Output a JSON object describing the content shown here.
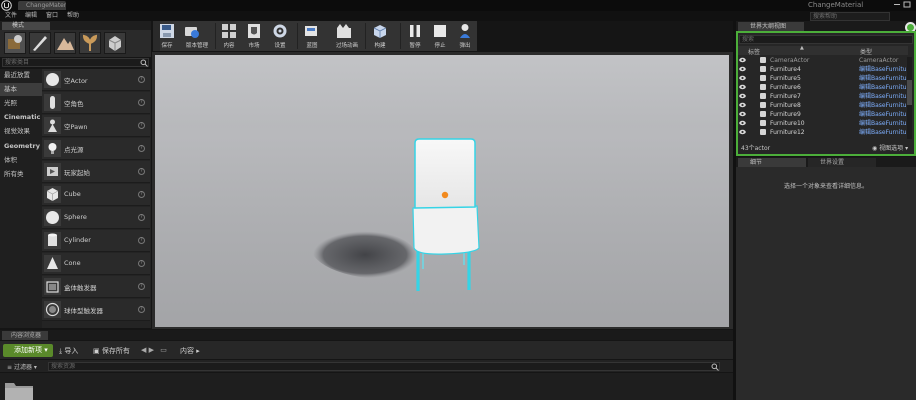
{
  "window": {
    "doc_tab": "ChangeMaterial",
    "title_right": "ChangeMaterial",
    "search_help_placeholder": "搜索帮助"
  },
  "menu": [
    "文件",
    "编辑",
    "窗口",
    "帮助"
  ],
  "modes": {
    "tab_label": "模式",
    "search_placeholder": "搜索类目",
    "categories": [
      "最近放置",
      "基本",
      "光照",
      "Cinematic",
      "视觉效果",
      "Geometry",
      "体积",
      "所有类"
    ],
    "active_category": "基本",
    "placeables": [
      "空Actor",
      "空角色",
      "空Pawn",
      "点光源",
      "玩家起始",
      "Cube",
      "Sphere",
      "Cylinder",
      "Cone",
      "盒体触发器",
      "球体型触发器"
    ]
  },
  "toolbar": {
    "buttons": [
      {
        "label": "保存",
        "icon": "save-icon"
      },
      {
        "label": "版本管理",
        "icon": "source-control-icon"
      },
      {
        "label": "内容",
        "icon": "content-icon"
      },
      {
        "label": "市场",
        "icon": "marketplace-icon"
      },
      {
        "label": "设置",
        "icon": "settings-icon"
      },
      {
        "label": "蓝图",
        "icon": "blueprints-icon"
      },
      {
        "label": "过场动画",
        "icon": "cinematics-icon"
      },
      {
        "label": "构建",
        "icon": "build-icon"
      },
      {
        "label": "暂停",
        "icon": "pause-icon"
      },
      {
        "label": "停止",
        "icon": "stop-icon"
      },
      {
        "label": "弹出",
        "icon": "eject-icon"
      }
    ]
  },
  "content_browser": {
    "tab_label": "内容浏览器",
    "add_new": "添加新项",
    "import": "导入",
    "save_all": "保存所有",
    "path": "内容",
    "filters": "过滤器",
    "search_placeholder": "搜索资源"
  },
  "world_outliner": {
    "tab_label": "世界大纲视图",
    "search_placeholder": "搜索",
    "col_label": "标签",
    "col_type": "类型",
    "rows": [
      {
        "name": "CameraActor",
        "type": "CameraActor"
      },
      {
        "name": "Furniture4",
        "type": "编辑BaseFurniture"
      },
      {
        "name": "Furniture5",
        "type": "编辑BaseFurniture"
      },
      {
        "name": "Furniture6",
        "type": "编辑BaseFurniture"
      },
      {
        "name": "Furniture7",
        "type": "编辑BaseFurniture"
      },
      {
        "name": "Furniture8",
        "type": "编辑BaseFurniture"
      },
      {
        "name": "Furniture9",
        "type": "编辑BaseFurniture"
      },
      {
        "name": "Furniture10",
        "type": "编辑BaseFurniture"
      },
      {
        "name": "Furniture12",
        "type": "编辑BaseFurniture"
      }
    ],
    "count": "43个actor",
    "view_options": "视图选项"
  },
  "details": {
    "tab_label": "细节",
    "world_settings_tab": "世界设置",
    "empty_message": "选择一个对象来查看详细信息。"
  },
  "colors": {
    "accent_green": "#4cae3a",
    "add_new_green": "#5a8a2a",
    "selection_cyan": "#35d4e6",
    "link_blue": "#7fb0ff"
  }
}
